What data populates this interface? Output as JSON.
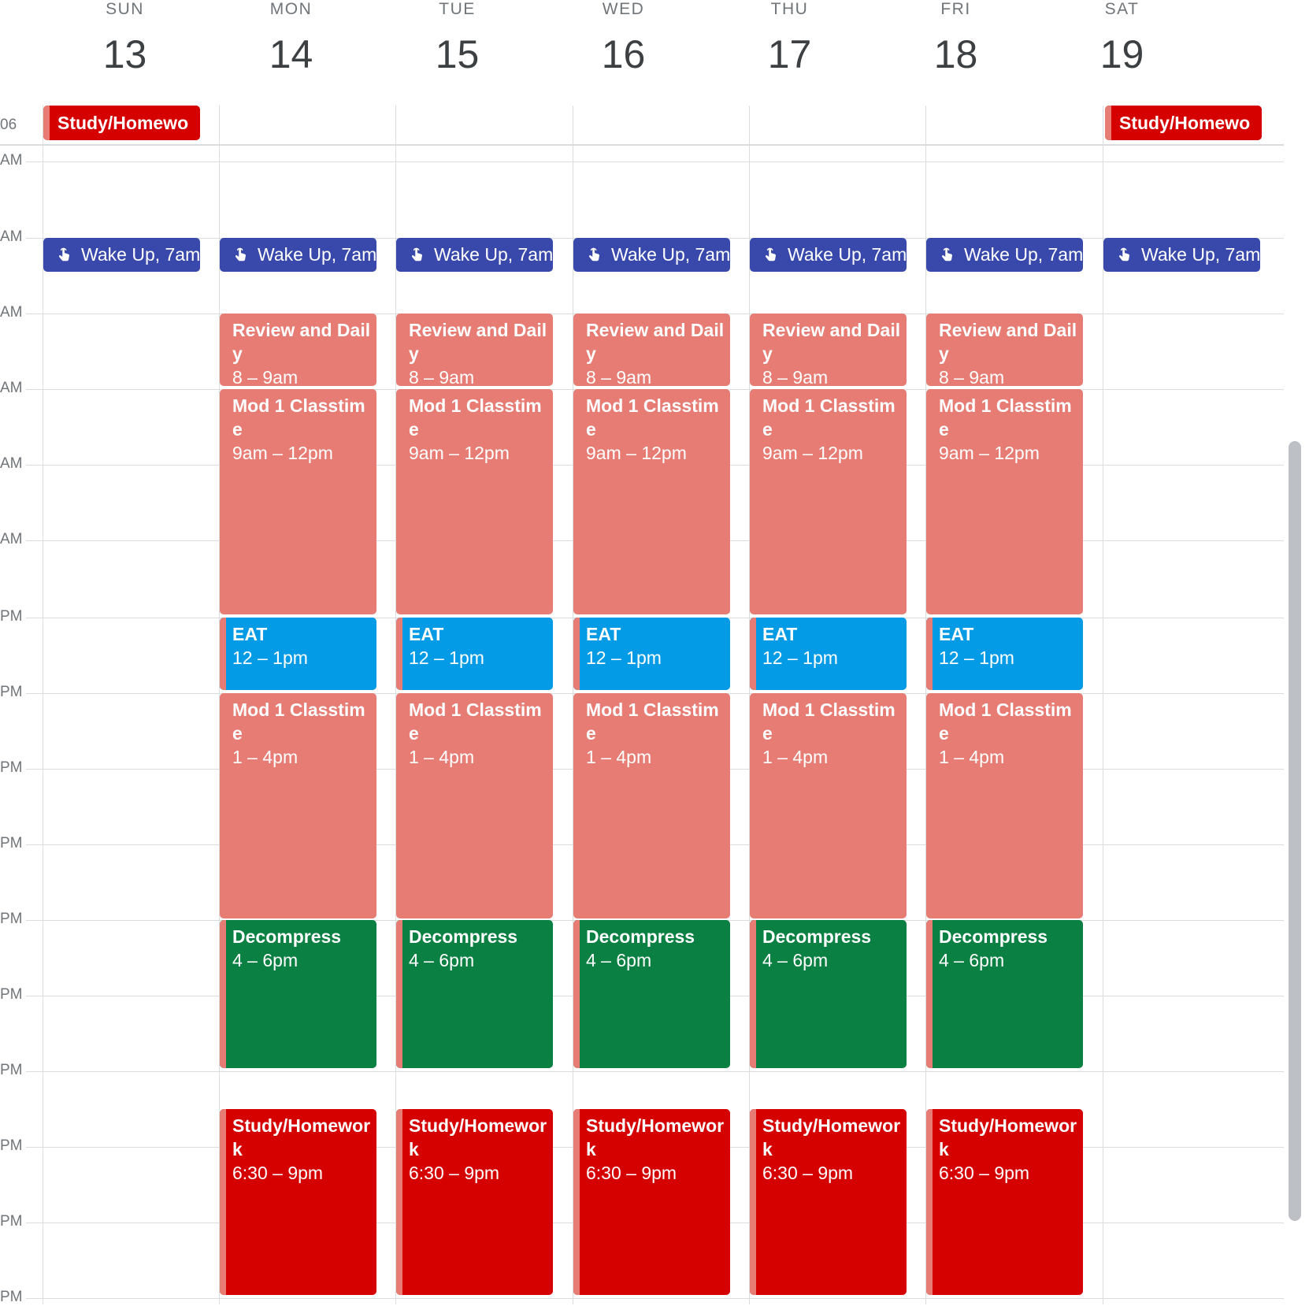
{
  "days": [
    {
      "dow": "SUN",
      "num": "13"
    },
    {
      "dow": "MON",
      "num": "14"
    },
    {
      "dow": "TUE",
      "num": "15"
    },
    {
      "dow": "WED",
      "num": "16"
    },
    {
      "dow": "THU",
      "num": "17"
    },
    {
      "dow": "FRI",
      "num": "18"
    },
    {
      "dow": "SAT",
      "num": "19"
    }
  ],
  "allday_label": "06",
  "time_labels": [
    "AM",
    "AM",
    "AM",
    "AM",
    "AM",
    "AM",
    "PM",
    "PM",
    "PM",
    "PM",
    "PM",
    "PM",
    "PM",
    "PM",
    "PM",
    "PM"
  ],
  "allday_event": {
    "title": "Study/Homewo"
  },
  "wake_event": {
    "title": "Wake Up,",
    "time": "7am",
    "icon": "hand-pointer-icon"
  },
  "weekday_events": {
    "review": {
      "title": "Review and Daily",
      "time": "8 – 9am"
    },
    "mod_morning": {
      "title": "Mod 1 Classtime",
      "time": "9am – 12pm"
    },
    "eat": {
      "title": "EAT",
      "time": "12 – 1pm"
    },
    "mod_afternoon": {
      "title": "Mod 1 Classtime",
      "time": "1 – 4pm"
    },
    "decompress": {
      "title": "Decompress",
      "time": "4 – 6pm"
    },
    "study": {
      "title": "Study/Homework",
      "time": "6:30 – 9pm"
    }
  },
  "colors": {
    "tomato_flamingo": "#e67c73",
    "peacock": "#039be5",
    "basil": "#0b8043",
    "tomato": "#d50000",
    "blueberry": "#3949ab"
  }
}
